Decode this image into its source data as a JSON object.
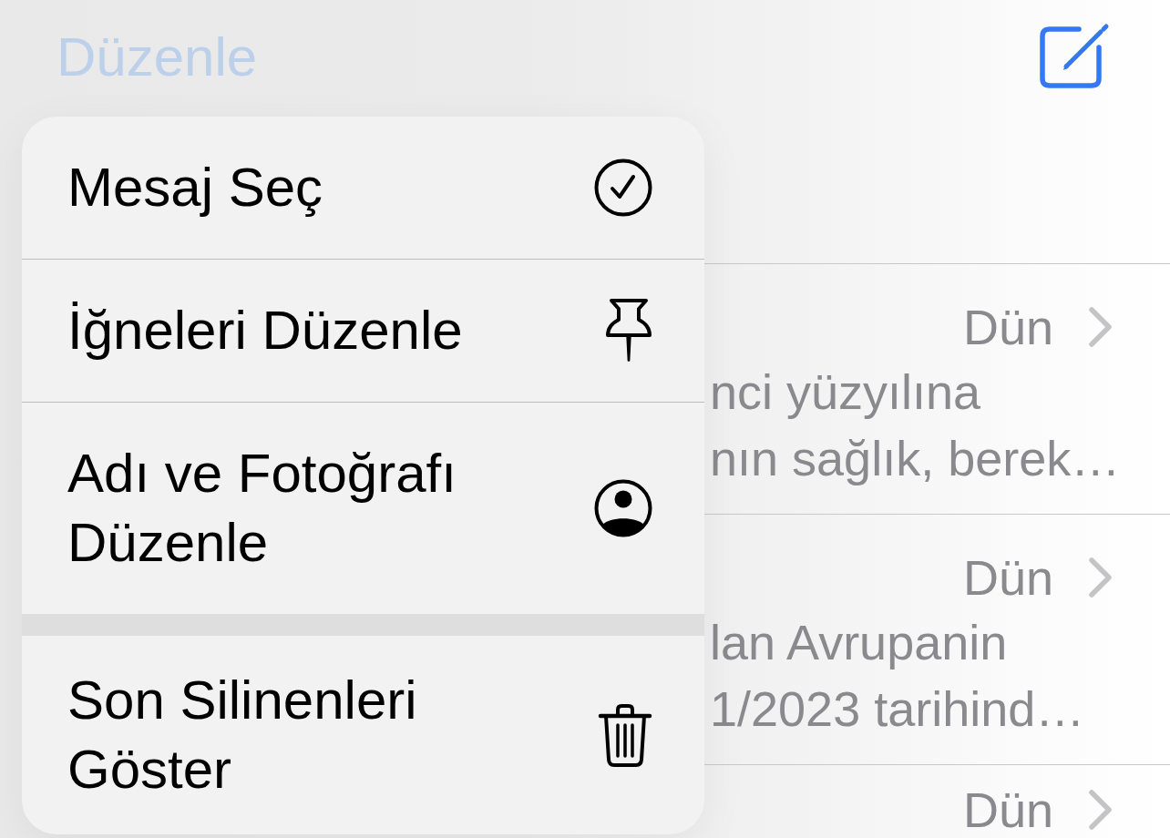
{
  "navigation_bar": {
    "edit_button": {
      "label": "Düzenle",
      "dimmed": true
    }
  },
  "context_menu": {
    "sections": [
      {
        "items": [
          {
            "kind": "select",
            "label": "Mesaj Seç"
          },
          {
            "kind": "pins",
            "label": "İğneleri Düzenle"
          },
          {
            "kind": "profile",
            "label": "Adı ve Fotoğrafı Düzenle"
          }
        ]
      },
      {
        "items": [
          {
            "kind": "trash",
            "label": "Son Silinenleri Göster"
          }
        ]
      }
    ]
  },
  "conversations": [
    {
      "time": "Dün",
      "preview_lines": [
        "nci yüzyılına",
        "nın sağlık, berek…"
      ]
    },
    {
      "time": "Dün",
      "preview_lines": [
        "lan Avrupanin",
        "1/2023 tarihind…"
      ]
    },
    {
      "time": "Dün"
    }
  ]
}
